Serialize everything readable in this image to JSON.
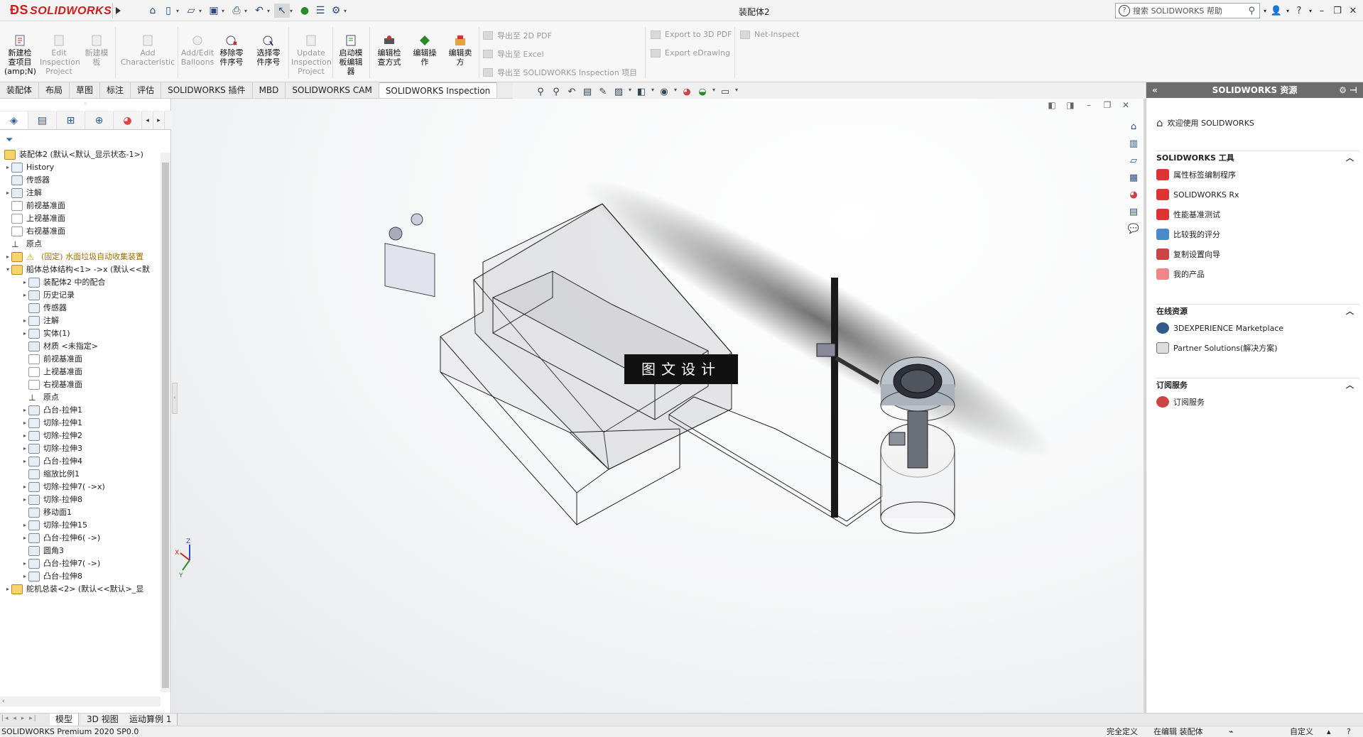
{
  "titlebar": {
    "logo": "SOLIDWORKS",
    "doc_title": "装配体2",
    "search_placeholder": "搜索 SOLIDWORKS 帮助"
  },
  "cmd": {
    "new_project": "新建检\n查项目\n(amp;N)",
    "edit_project": "Edit\nInspection\nProject",
    "new_template": "新建模\n板",
    "add_characteristic": "Add\nCharacteristic",
    "add_edit_balloons": "Add/Edit\nBalloons",
    "remove_part_number": "移除零\n件序号",
    "select_part_number": "选择零\n件序号",
    "update_project": "Update\nInspection\nProject",
    "launch_template_editor": "启动模\n板编辑\n器",
    "edit_inspection_method": "编辑检\n查方式",
    "edit_operation": "编辑操\n作",
    "edit_vendor": "编辑卖\n方",
    "export_2d_pdf": "导出至 2D PDF",
    "export_excel": "导出至 Excel",
    "export_sw_project": "导出至 SOLIDWORKS Inspection 项目",
    "export_3d_pdf": "Export to 3D PDF",
    "export_edrawing": "Export eDrawing",
    "net_inspect": "Net-Inspect"
  },
  "tabs": [
    "装配体",
    "布局",
    "草图",
    "标注",
    "评估",
    "SOLIDWORKS 插件",
    "MBD",
    "SOLIDWORKS CAM",
    "SOLIDWORKS Inspection"
  ],
  "tree": {
    "root": "装配体2 (默认<默认_显示状态-1>)",
    "items": [
      "History",
      "传感器",
      "注解",
      "前视基准面",
      "上视基准面",
      "右视基准面",
      "原点",
      "(固定) 水面垃圾自动收集装置",
      "船体总体结构<1> ->x (默认<<默",
      "装配体2 中的配合",
      "历史记录",
      "传感器",
      "注解",
      "实体(1)",
      "材质 <未指定>",
      "前视基准面",
      "上视基准面",
      "右视基准面",
      "原点",
      "凸台-拉伸1",
      "切除-拉伸1",
      "切除-拉伸2",
      "切除-拉伸3",
      "凸台-拉伸4",
      "缩放比例1",
      "切除-拉伸7( ->x)",
      "切除-拉伸8",
      "移动面1",
      "切除-拉伸15",
      "凸台-拉伸6( ->)",
      "圆角3",
      "凸台-拉伸7( ->)",
      "凸台-拉伸8",
      "舵机总装<2> (默认<<默认>_显"
    ]
  },
  "viewport": {
    "watermark": "图文设计"
  },
  "resources": {
    "title": "SOLIDWORKS 资源",
    "welcome": "欢迎使用 SOLIDWORKS",
    "tools_title": "SOLIDWORKS 工具",
    "tools": [
      "属性标签编制程序",
      "SOLIDWORKS Rx",
      "性能基准测试",
      "比较我的评分",
      "复制设置向导",
      "我的产品"
    ],
    "online_title": "在线资源",
    "online": [
      "3DEXPERIENCE Marketplace",
      "Partner Solutions(解决方案)"
    ],
    "subscription_title": "订阅服务",
    "subscription": [
      "订阅服务"
    ]
  },
  "bottom_tabs": [
    "模型",
    "3D 视图",
    "运动算例 1"
  ],
  "status": {
    "product": "SOLIDWORKS Premium 2020 SP0.0",
    "fully_defined": "完全定义",
    "editing": "在编辑 装配体",
    "custom": "自定义"
  },
  "colors": {
    "brand_red": "#d31b1b",
    "resources_header": "#6c6c6c",
    "accent_blue": "#2a5a9a"
  }
}
